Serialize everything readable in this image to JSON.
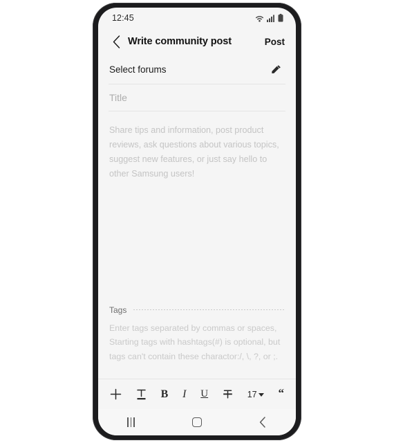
{
  "status_bar": {
    "time": "12:45",
    "icons": [
      "wifi-icon",
      "signal-icon",
      "battery-icon"
    ]
  },
  "app_bar": {
    "back_icon": "chevron-left-icon",
    "title": "Write community post",
    "post_label": "Post"
  },
  "forums": {
    "label": "Select forums",
    "edit_icon": "pencil-icon"
  },
  "title_field": {
    "value": "",
    "placeholder": "Title"
  },
  "body_field": {
    "value": "",
    "placeholder": "Share tips and information, post product reviews, ask questions about various topics, suggest new features, or just say hello to other Samsung users!"
  },
  "tags": {
    "label": "Tags",
    "value": "",
    "hint": "Enter tags separated by commas or spaces, Starting tags with hashtags(#) is optional, but tags can't contain these charactor:/, \\, ?, or ;."
  },
  "toolbar": {
    "add_label": "+",
    "text_format_icon": "text-format-icon",
    "bold_label": "B",
    "italic_label": "I",
    "underline_label": "U",
    "strikethrough_icon": "strikethrough-icon",
    "font_size": "17",
    "font_size_caret": "chevron-down-icon",
    "quote_label": "“"
  },
  "nav_bar": {
    "recents": "recents-icon",
    "home": "home-icon",
    "back": "back-icon"
  },
  "colors": {
    "screen_bg": "#f5f5f5",
    "frame": "#1c1c1e",
    "text_primary": "#121212",
    "placeholder": "#c4c4c4",
    "divider": "#e4e4e4"
  }
}
